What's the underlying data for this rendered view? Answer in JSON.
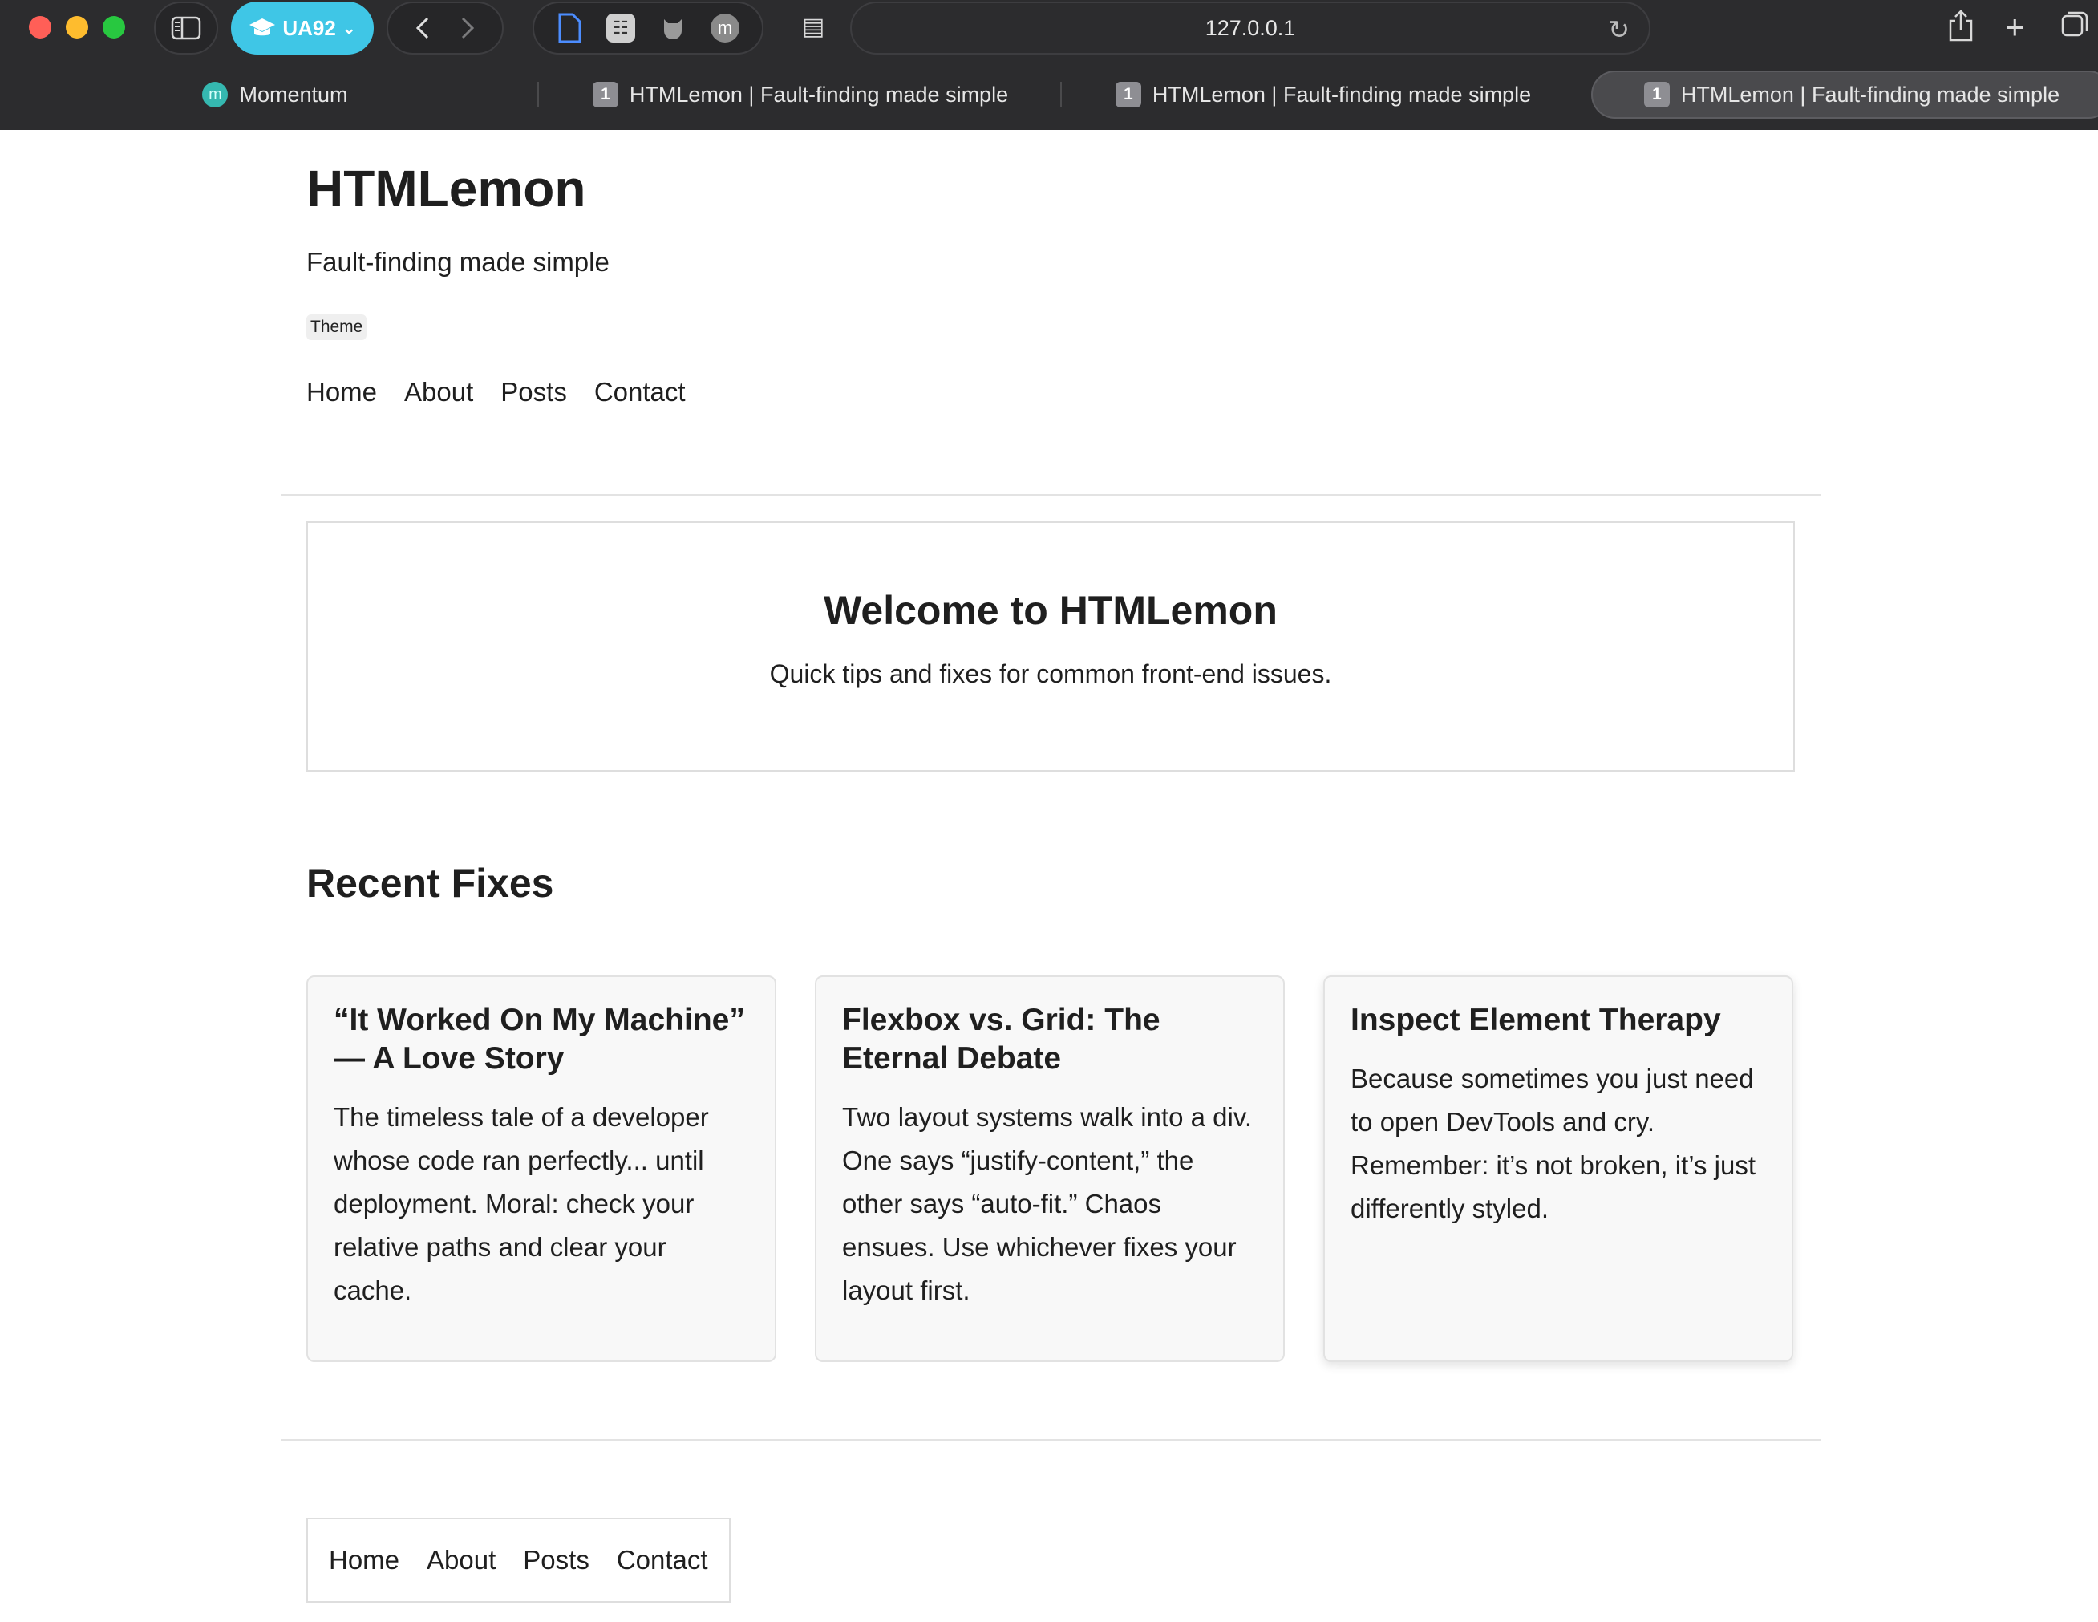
{
  "browser": {
    "profile_label": "UA92",
    "url": "127.0.0.1",
    "tabs": [
      {
        "title": "Momentum",
        "favicon": "m"
      },
      {
        "title": "HTMLemon | Fault-finding made simple",
        "badge": "1"
      },
      {
        "title": "HTMLemon | Fault-finding made simple",
        "badge": "1"
      },
      {
        "title": "HTMLemon | Fault-finding made simple",
        "badge": "1",
        "active": true
      }
    ],
    "extension_avatar": "m",
    "accent_color": "#3fc6e6"
  },
  "site": {
    "title": "HTMLemon",
    "tagline": "Fault-finding made simple",
    "theme_button": "Theme",
    "nav": [
      "Home",
      "About",
      "Posts",
      "Contact"
    ]
  },
  "hero": {
    "title": "Welcome to HTMLemon",
    "subtitle": "Quick tips and fixes for common front-end issues."
  },
  "recent": {
    "heading": "Recent Fixes",
    "cards": [
      {
        "title": "“It Worked On My Machine” — A Love Story",
        "body": "The timeless tale of a developer whose code ran perfectly... until deployment. Moral: check your relative paths and clear your cache."
      },
      {
        "title": "Flexbox vs. Grid: The Eternal Debate",
        "body": "Two layout systems walk into a div. One says “justify-content,” the other says “auto-fit.” Chaos ensues. Use whichever fixes your layout first."
      },
      {
        "title": "Inspect Element Therapy",
        "body": "Because sometimes you just need to open DevTools and cry. Remember: it’s not broken, it’s just differently styled."
      }
    ]
  },
  "footer": {
    "nav": [
      "Home",
      "About",
      "Posts",
      "Contact"
    ]
  }
}
